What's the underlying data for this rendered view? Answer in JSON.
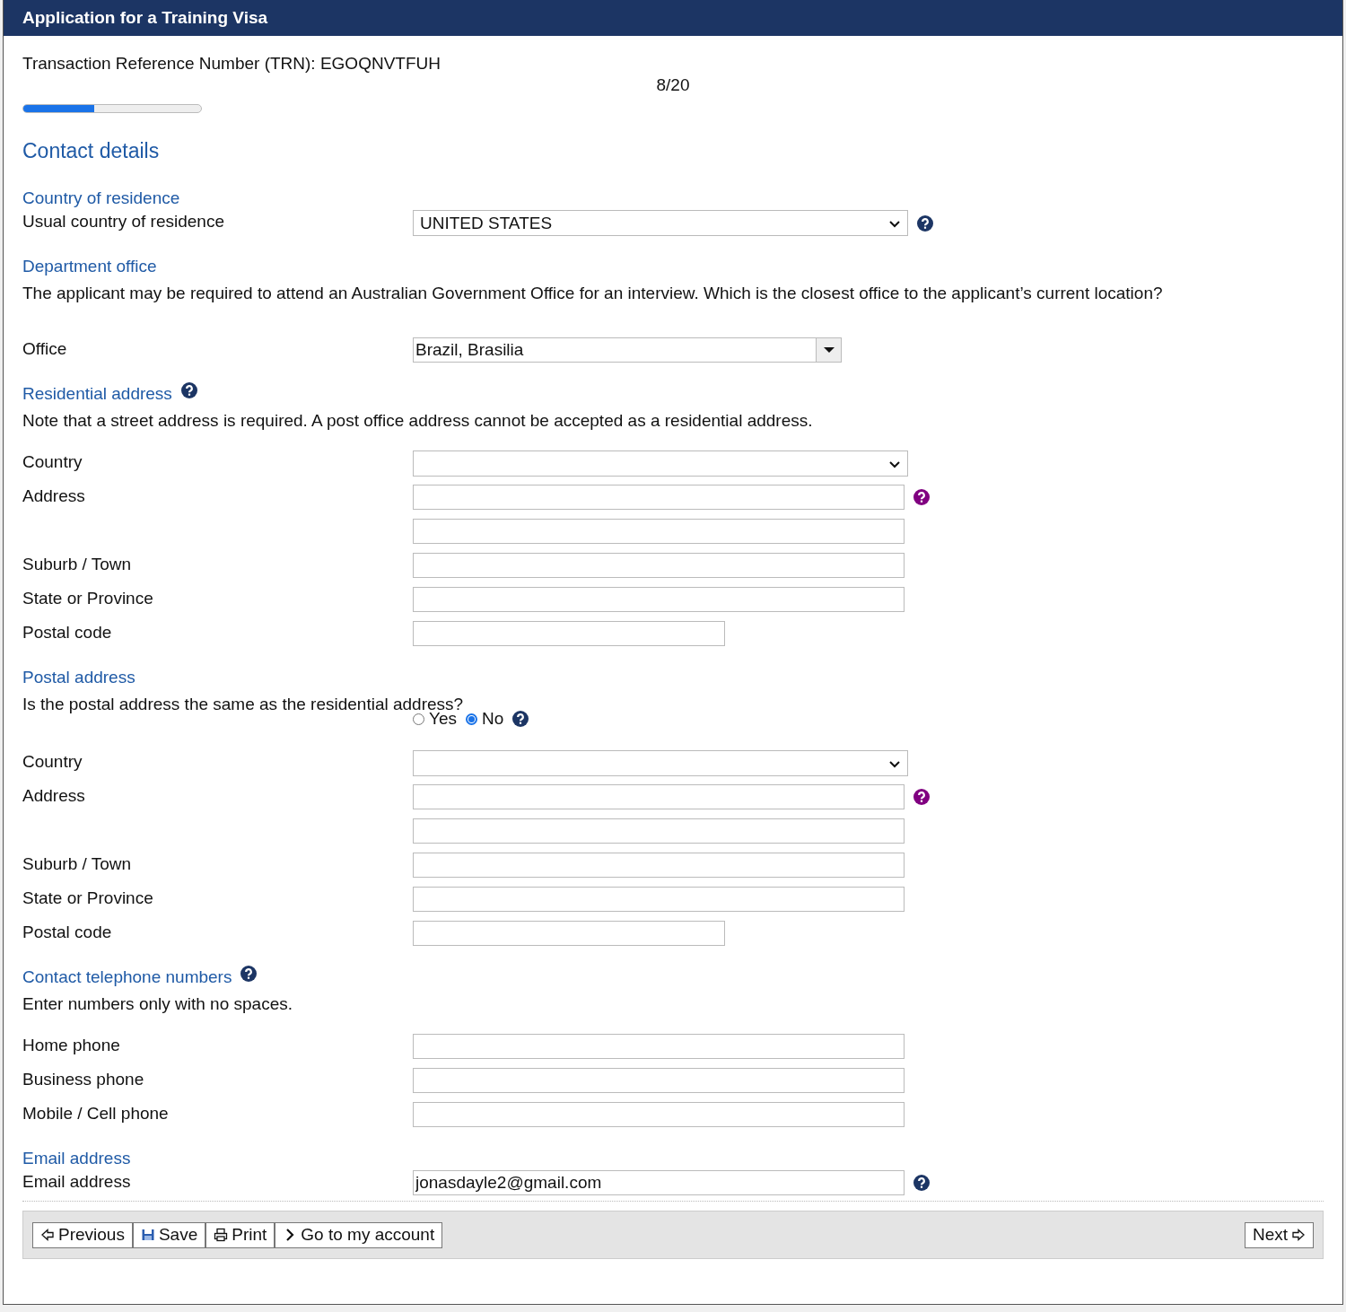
{
  "window": {
    "title": "Application for a Training Visa"
  },
  "trn": "Transaction Reference Number (TRN): EGOQNVTFUH",
  "progress": {
    "label": "8/20",
    "level": 0.4
  },
  "page_title": "Contact details",
  "sections": [
    {
      "heading": "Country of residence",
      "rows": [
        {
          "kind": "select",
          "label": "Usual country of residence",
          "value": "UNITED STATES",
          "help": {
            "color": "#1c3564"
          }
        }
      ]
    },
    {
      "heading": "Department office",
      "note": "The applicant may be required to attend an Australian Government Office for an interview. Which is the closest office to the applicant’s current location?",
      "rows": [
        {
          "kind": "combo",
          "label": "Office",
          "value": "Brazil, Brasilia"
        }
      ]
    },
    {
      "heading": "Residential address",
      "help": {
        "color": "#1c3564"
      },
      "note": "Note that a street address is required. A post office address cannot be accepted as a residential address.",
      "rows": [
        {
          "kind": "select",
          "label": "Country"
        },
        {
          "kind": "address",
          "label": "Address",
          "help": {
            "color": "#800080"
          }
        },
        {
          "kind": "text",
          "label": "Suburb / Town"
        },
        {
          "kind": "text",
          "label": "State or Province"
        },
        {
          "kind": "short",
          "label": "Postal code"
        }
      ]
    },
    {
      "heading": "Postal address",
      "question": "Is the postal address the same as the residential address?",
      "rows": [
        {
          "kind": "radio",
          "options": [
            {
              "label": "Yes",
              "selected": false
            },
            {
              "label": "No",
              "selected": true
            }
          ],
          "help": {
            "color": "#1c3564"
          }
        },
        {
          "kind": "select",
          "label": "Country"
        },
        {
          "kind": "address",
          "label": "Address",
          "help": {
            "color": "#800080"
          }
        },
        {
          "kind": "text",
          "label": "Suburb / Town"
        },
        {
          "kind": "text",
          "label": "State or Province"
        },
        {
          "kind": "short",
          "label": "Postal code"
        }
      ]
    },
    {
      "heading": "Contact telephone numbers",
      "help": {
        "color": "#1c3564"
      },
      "note": "Enter numbers only with no spaces.",
      "rows": [
        {
          "kind": "text",
          "label": "Home phone"
        },
        {
          "kind": "text",
          "label": "Business phone"
        },
        {
          "kind": "text",
          "label": "Mobile / Cell phone"
        }
      ]
    },
    {
      "heading": "Email address",
      "rows": [
        {
          "kind": "text",
          "label": "Email address",
          "value": "jonasdayle2@gmail.com",
          "help": {
            "color": "#1c3564"
          }
        }
      ]
    }
  ],
  "buttons_left": [
    {
      "kind": "previous",
      "label": "Previous"
    },
    {
      "kind": "save",
      "label": "Save"
    },
    {
      "kind": "print",
      "label": "Print"
    },
    {
      "kind": "account",
      "label": "Go to my account"
    }
  ],
  "buttons_right": [
    {
      "kind": "next",
      "label": "Next"
    }
  ]
}
